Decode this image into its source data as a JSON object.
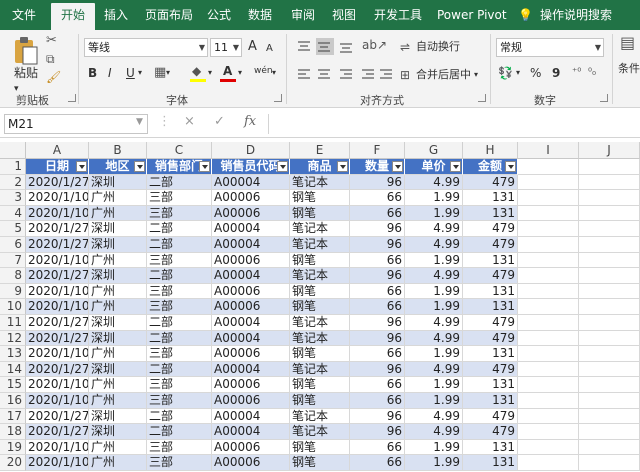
{
  "tabs": [
    "文件",
    "开始",
    "插入",
    "页面布局",
    "公式",
    "数据",
    "审阅",
    "视图",
    "开发工具",
    "Power Pivot",
    "操作说明搜索"
  ],
  "ribbon": {
    "clipboard": {
      "paste": "粘贴",
      "label": "剪贴板"
    },
    "font": {
      "name": "等线",
      "size": "11",
      "grow": "A",
      "shrink": "A",
      "bold": "B",
      "italic": "I",
      "underline": "U",
      "font_color": "A",
      "phonetic": "wén",
      "label": "字体"
    },
    "alignment": {
      "wrap": "自动换行",
      "merge": "合并后居中",
      "label": "对齐方式"
    },
    "number": {
      "format": "常规",
      "percent": "%",
      "comma": "9",
      "label": "数字"
    },
    "styles": {
      "conditional": "条件"
    }
  },
  "formula_bar": {
    "name_box": "M21",
    "cancel": "×",
    "enter": "✓",
    "fx": "fx",
    "formula": ""
  },
  "columns": [
    "A",
    "B",
    "C",
    "D",
    "E",
    "F",
    "G",
    "H",
    "I",
    "J"
  ],
  "header": [
    "日期",
    "地区",
    "销售部门",
    "销售员代码",
    "商品",
    "数量",
    "单价",
    "金额"
  ],
  "rows": [
    [
      "2020/1/27",
      "深圳",
      "二部",
      "A00004",
      "笔记本",
      "96",
      "4.99",
      "479"
    ],
    [
      "2020/1/10",
      "广州",
      "三部",
      "A00006",
      "钢笔",
      "66",
      "1.99",
      "131"
    ],
    [
      "2020/1/10",
      "广州",
      "三部",
      "A00006",
      "钢笔",
      "66",
      "1.99",
      "131"
    ],
    [
      "2020/1/27",
      "深圳",
      "二部",
      "A00004",
      "笔记本",
      "96",
      "4.99",
      "479"
    ],
    [
      "2020/1/27",
      "深圳",
      "二部",
      "A00004",
      "笔记本",
      "96",
      "4.99",
      "479"
    ],
    [
      "2020/1/10",
      "广州",
      "三部",
      "A00006",
      "钢笔",
      "66",
      "1.99",
      "131"
    ],
    [
      "2020/1/27",
      "深圳",
      "二部",
      "A00004",
      "笔记本",
      "96",
      "4.99",
      "479"
    ],
    [
      "2020/1/10",
      "广州",
      "三部",
      "A00006",
      "钢笔",
      "66",
      "1.99",
      "131"
    ],
    [
      "2020/1/10",
      "广州",
      "三部",
      "A00006",
      "钢笔",
      "66",
      "1.99",
      "131"
    ],
    [
      "2020/1/27",
      "深圳",
      "二部",
      "A00004",
      "笔记本",
      "96",
      "4.99",
      "479"
    ],
    [
      "2020/1/27",
      "深圳",
      "二部",
      "A00004",
      "笔记本",
      "96",
      "4.99",
      "479"
    ],
    [
      "2020/1/10",
      "广州",
      "三部",
      "A00006",
      "钢笔",
      "66",
      "1.99",
      "131"
    ],
    [
      "2020/1/27",
      "深圳",
      "二部",
      "A00004",
      "笔记本",
      "96",
      "4.99",
      "479"
    ],
    [
      "2020/1/10",
      "广州",
      "三部",
      "A00006",
      "钢笔",
      "66",
      "1.99",
      "131"
    ],
    [
      "2020/1/10",
      "广州",
      "三部",
      "A00006",
      "钢笔",
      "66",
      "1.99",
      "131"
    ],
    [
      "2020/1/27",
      "深圳",
      "二部",
      "A00004",
      "笔记本",
      "96",
      "4.99",
      "479"
    ],
    [
      "2020/1/27",
      "深圳",
      "二部",
      "A00004",
      "笔记本",
      "96",
      "4.99",
      "479"
    ],
    [
      "2020/1/10",
      "广州",
      "三部",
      "A00006",
      "钢笔",
      "66",
      "1.99",
      "131"
    ],
    [
      "2020/1/10",
      "广州",
      "三部",
      "A00006",
      "钢笔",
      "66",
      "1.99",
      "131"
    ]
  ]
}
